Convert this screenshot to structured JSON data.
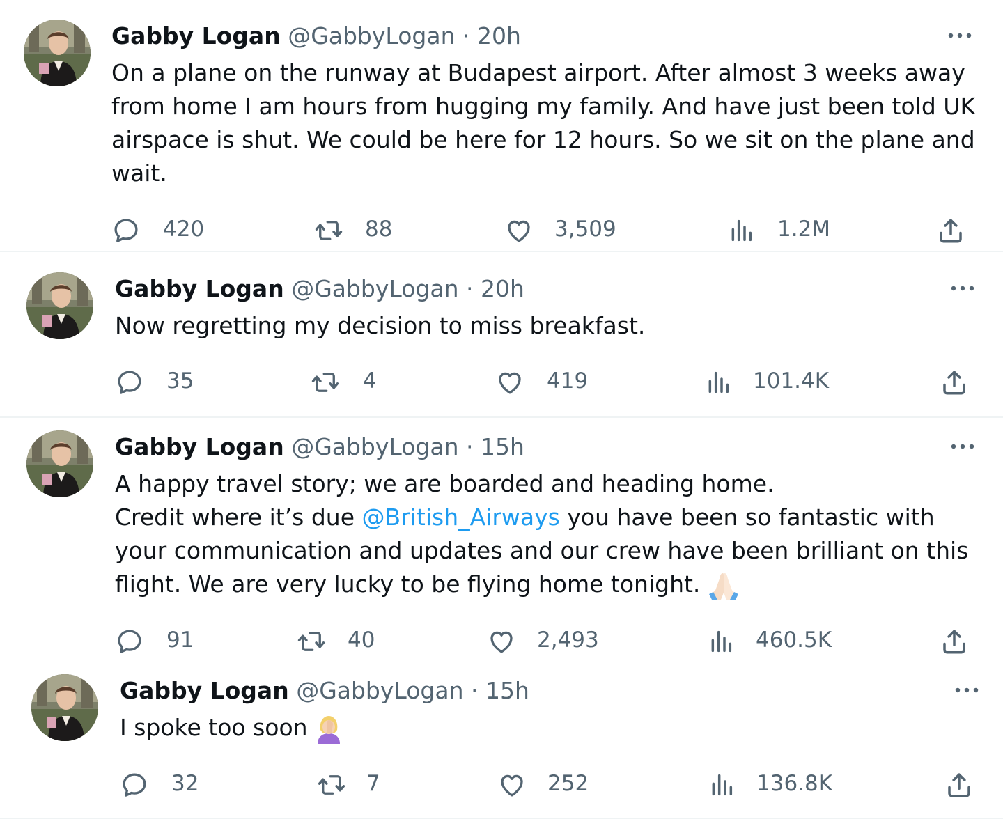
{
  "tweets": [
    {
      "name": "Gabby Logan",
      "handle": "@GabbyLogan",
      "separator": "·",
      "time": "20h",
      "lines": [
        "On a plane on the runway at Budapest airport. After almost 3 weeks away",
        "from home I am hours from hugging my family. And have just been told UK",
        "airspace is shut. We could be here for 12 hours. So we sit on the plane and",
        "wait."
      ],
      "replies": "420",
      "retweets": "88",
      "likes": "3,509",
      "views": "1.2M"
    },
    {
      "name": "Gabby Logan",
      "handle": "@GabbyLogan",
      "separator": "·",
      "time": "20h",
      "lines": [
        "Now regretting my decision to miss breakfast."
      ],
      "replies": "35",
      "retweets": "4",
      "likes": "419",
      "views": "101.4K"
    },
    {
      "name": "Gabby Logan",
      "handle": "@GabbyLogan",
      "separator": "·",
      "time": "15h",
      "line1": "A happy travel story; we are boarded and heading home.",
      "line2_pre": "Credit where it’s due ",
      "line2_mention": "@British_Airways",
      "line2_post": " you have been so fantastic with",
      "line3": "your communication and updates and our crew have been brilliant on this",
      "line4": "flight. We are very lucky to be flying home tonight.",
      "emoji": "folded-hands-emoji",
      "replies": "91",
      "retweets": "40",
      "likes": "2,493",
      "views": "460.5K"
    },
    {
      "name": "Gabby Logan",
      "handle": "@GabbyLogan",
      "separator": "·",
      "time": "15h",
      "line1": "I spoke too soon",
      "emoji": "woman-facepalming-emoji",
      "replies": "32",
      "retweets": "7",
      "likes": "252",
      "views": "136.8K"
    }
  ],
  "colors": {
    "text": "#0f1419",
    "secondary": "#536471",
    "link": "#1d9bf0",
    "divider": "#eff3f4"
  },
  "icons": [
    "reply-icon",
    "retweet-icon",
    "like-icon",
    "views-icon",
    "share-icon",
    "more-icon"
  ]
}
